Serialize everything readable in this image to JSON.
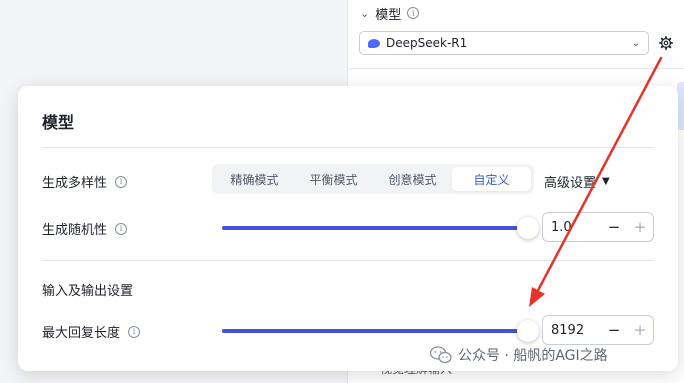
{
  "background_panel": {
    "section_title": "模型",
    "model_select_value": "DeepSeek-R1",
    "bottom_text": "视觉理解输入"
  },
  "modal": {
    "title": "模型",
    "diversity": {
      "label": "生成多样性",
      "modes": [
        "精确模式",
        "平衡模式",
        "创意模式",
        "自定义"
      ],
      "active_index": 3,
      "advanced_label": "高级设置"
    },
    "randomness": {
      "label": "生成随机性",
      "value": "1.0",
      "level": 1.0
    },
    "io_section_title": "输入及输出设置",
    "max_length": {
      "label": "最大回复长度",
      "value": "8192",
      "level": 1.0
    }
  },
  "stepper_labels": {
    "minus": "−",
    "plus": "+"
  },
  "watermark": {
    "text": "公众号 · 船帆的AGI之路"
  },
  "colors": {
    "accent": "#4254d6",
    "annotation": "#e8322b",
    "active_tab": "#3b5bdb"
  }
}
